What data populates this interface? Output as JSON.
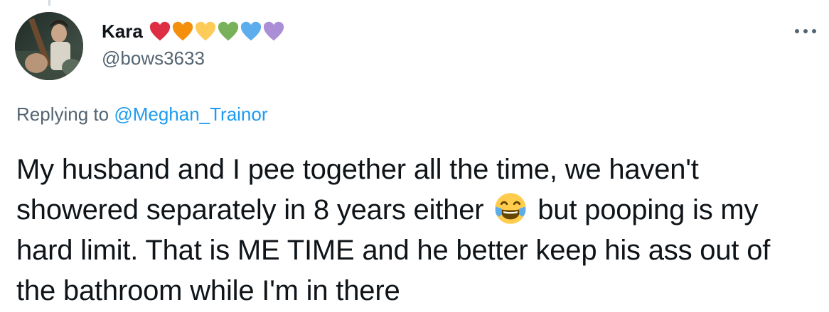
{
  "tweet": {
    "author": {
      "display_name": "Kara",
      "handle": "@bows3633",
      "avatar_icon": "avatar-image",
      "name_emojis": [
        {
          "icon": "red-heart-icon",
          "color": "#dd2e44"
        },
        {
          "icon": "orange-heart-icon",
          "color": "#f4900c"
        },
        {
          "icon": "yellow-heart-icon",
          "color": "#fdcb58"
        },
        {
          "icon": "green-heart-icon",
          "color": "#78b159"
        },
        {
          "icon": "blue-heart-icon",
          "color": "#5dadec"
        },
        {
          "icon": "purple-heart-icon",
          "color": "#aa8ed6"
        }
      ]
    },
    "more_icon": "more-horizontal-icon",
    "reply_context": {
      "prefix": "Replying to",
      "mention": "@Meghan_Trainor"
    },
    "text": {
      "part1": "My husband and I pee together all the time, we haven't showered separately in 8 years either",
      "emoji_icon": "face-with-tears-of-joy-icon",
      "part2": "but pooping is my hard limit. That is ME TIME and he better keep his ass out of the bathroom while I'm in there"
    }
  },
  "colors": {
    "text_primary": "#0f1419",
    "text_secondary": "#536471",
    "link": "#1d9bf0"
  }
}
